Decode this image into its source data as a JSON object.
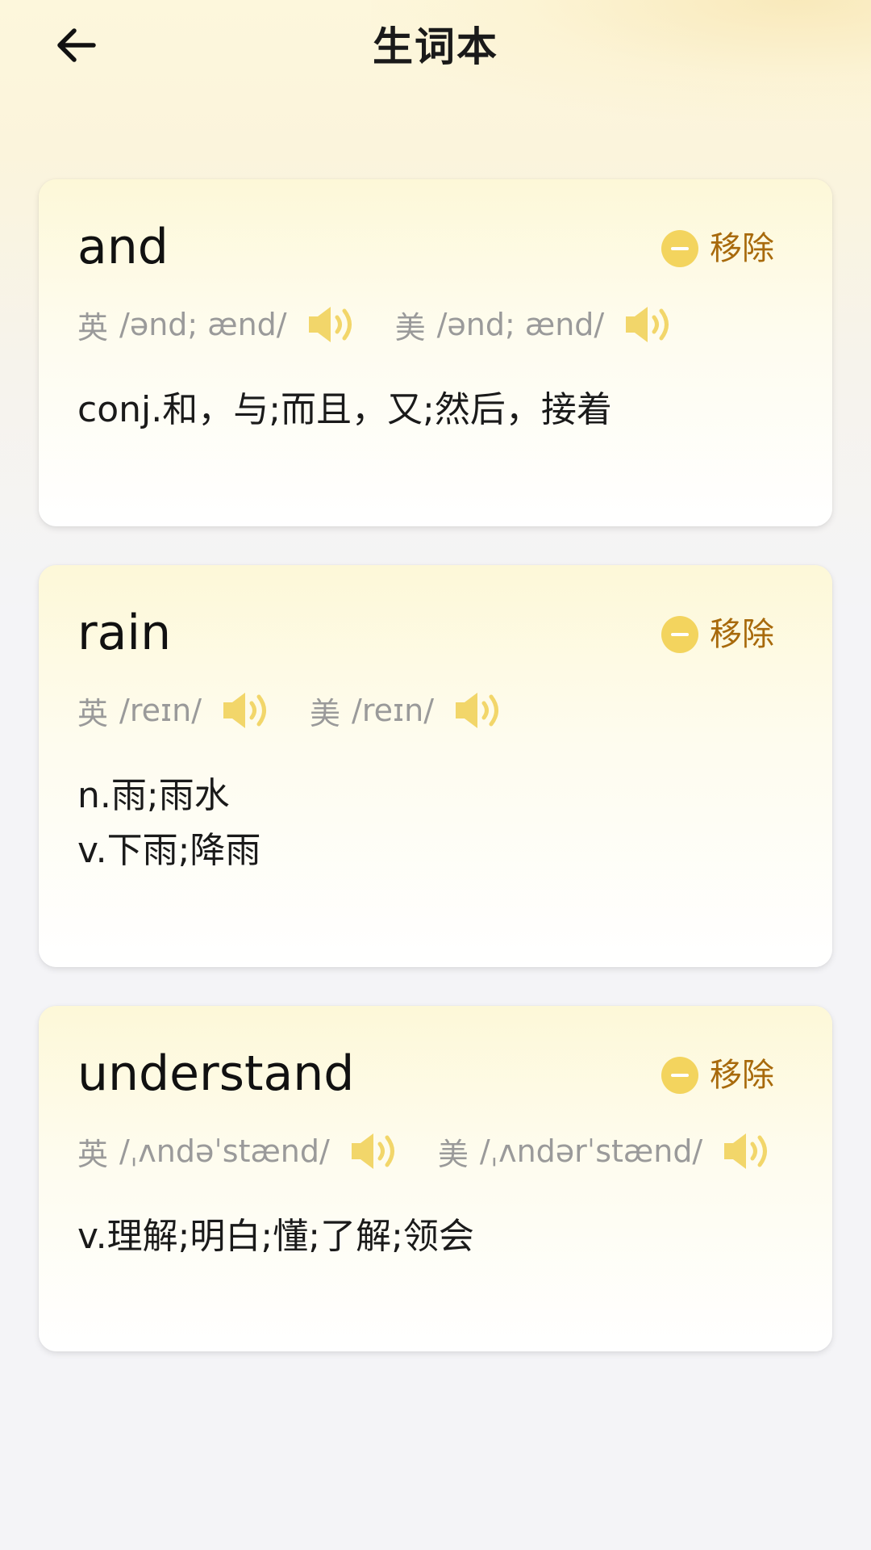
{
  "header": {
    "title": "生词本",
    "back_icon": "arrow-left-icon"
  },
  "colors": {
    "accent_yellow": "#f3d45e",
    "remove_text": "#a86a0c",
    "phonetic_gray": "#9a9a9a",
    "speaker_yellow": "#f2d66a"
  },
  "words": [
    {
      "word": "and",
      "remove_label": "移除",
      "uk": {
        "label": "英",
        "ipa": "/ənd; ænd/"
      },
      "us": {
        "label": "美",
        "ipa": "/ənd; ænd/"
      },
      "definitions": [
        "conj.和，与;而且，又;然后，接着"
      ]
    },
    {
      "word": "rain",
      "remove_label": "移除",
      "uk": {
        "label": "英",
        "ipa": "/reɪn/"
      },
      "us": {
        "label": "美",
        "ipa": "/reɪn/"
      },
      "definitions": [
        "n.雨;雨水",
        "v.下雨;降雨"
      ]
    },
    {
      "word": "understand",
      "remove_label": "移除",
      "uk": {
        "label": "英",
        "ipa": "/ˌʌndəˈstænd/"
      },
      "us": {
        "label": "美",
        "ipa": "/ˌʌndərˈstænd/"
      },
      "definitions": [
        "v.理解;明白;懂;了解;领会"
      ]
    }
  ]
}
